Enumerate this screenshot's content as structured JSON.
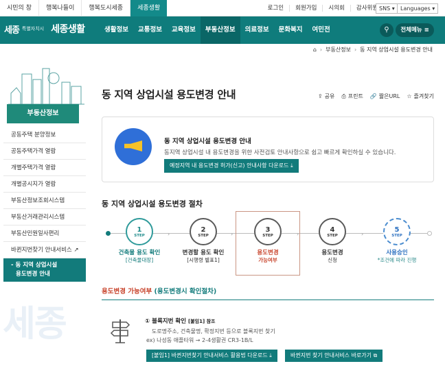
{
  "top_tabs": [
    "시민의 창",
    "행복나들이",
    "행복도시세종",
    "세종생활"
  ],
  "util_links": [
    "로그인",
    "회원가입",
    "시의회",
    "감사위원회"
  ],
  "sns_label": "SNS",
  "languages_label": "Languages",
  "logo": {
    "mark": "세종",
    "sub": "특별자치시",
    "name": "세종생활"
  },
  "gnb": [
    "생활정보",
    "교통정보",
    "교육정보",
    "부동산정보",
    "의료정보",
    "문화복지",
    "여민전"
  ],
  "all_menu": "전체메뉴",
  "breadcrumb": [
    "부동산정보",
    "동 지역 상업시설 용도변경 안내"
  ],
  "sidebar": {
    "title": "부동산정보",
    "items": [
      "공동주택 분양정보",
      "공동주택가격 열람",
      "개별주택가격 열람",
      "개별공시지가 열람",
      "부동산정보조회시스템",
      "부동산거래관리시스템",
      "부동산민원일사편리",
      "바뀐지번찾기 안내서비스",
      "동 지역 상업시설",
      "용도변경 안내"
    ],
    "watermark": "세종"
  },
  "page_title": "동 지역 상업시설 용도변경 안내",
  "tools": [
    "공유",
    "프린트",
    "짧은URL",
    "즐겨찾기"
  ],
  "intro": {
    "title": "동 지역 상업시설 용도변경 안내",
    "desc": "동지역 상업시설 내 용도변경을 위한 사전검토 안내사항으로 쉽고 빠르게 확인하실 수 있습니다.",
    "button": "예정지역 내 용도변경 허가(신고) 안내사항 다운로드"
  },
  "process_title": "동 지역 상업시설 용도변경 절차",
  "steps": [
    {
      "num": "1",
      "label": "STEP",
      "name": "건축물 용도 확인",
      "sub": "[건축물대장]"
    },
    {
      "num": "2",
      "label": "STEP",
      "name": "변경할 용도 확인",
      "sub": "[시행령 별표1]"
    },
    {
      "num": "3",
      "label": "STEP",
      "name": "용도변경",
      "sub": "가능여부"
    },
    {
      "num": "4",
      "label": "STEP",
      "name": "용도변경",
      "sub": "신청"
    },
    {
      "num": "5",
      "label": "STEP",
      "name": "사용승인",
      "sub": "*조건에 따라 진행"
    }
  ],
  "sub_heading": {
    "red": "용도변경 가능여부",
    "teal": "(용도변경시 확인절차)"
  },
  "item": {
    "title": "① 블록지번 확인",
    "tag": "[붙임1] 참조",
    "desc": "도로명주소, 건축물명, 확정지번 등으로 블록지번 찾기",
    "example": "ex) 나성동 애플타워 → 2-4생활권 CR3-1B/L",
    "button1": "[붙임1] 바뀐지번찾기 안내서비스 활용법 다운로드",
    "button2": "바뀐지번 찾기 안내서비스 바로가기"
  }
}
